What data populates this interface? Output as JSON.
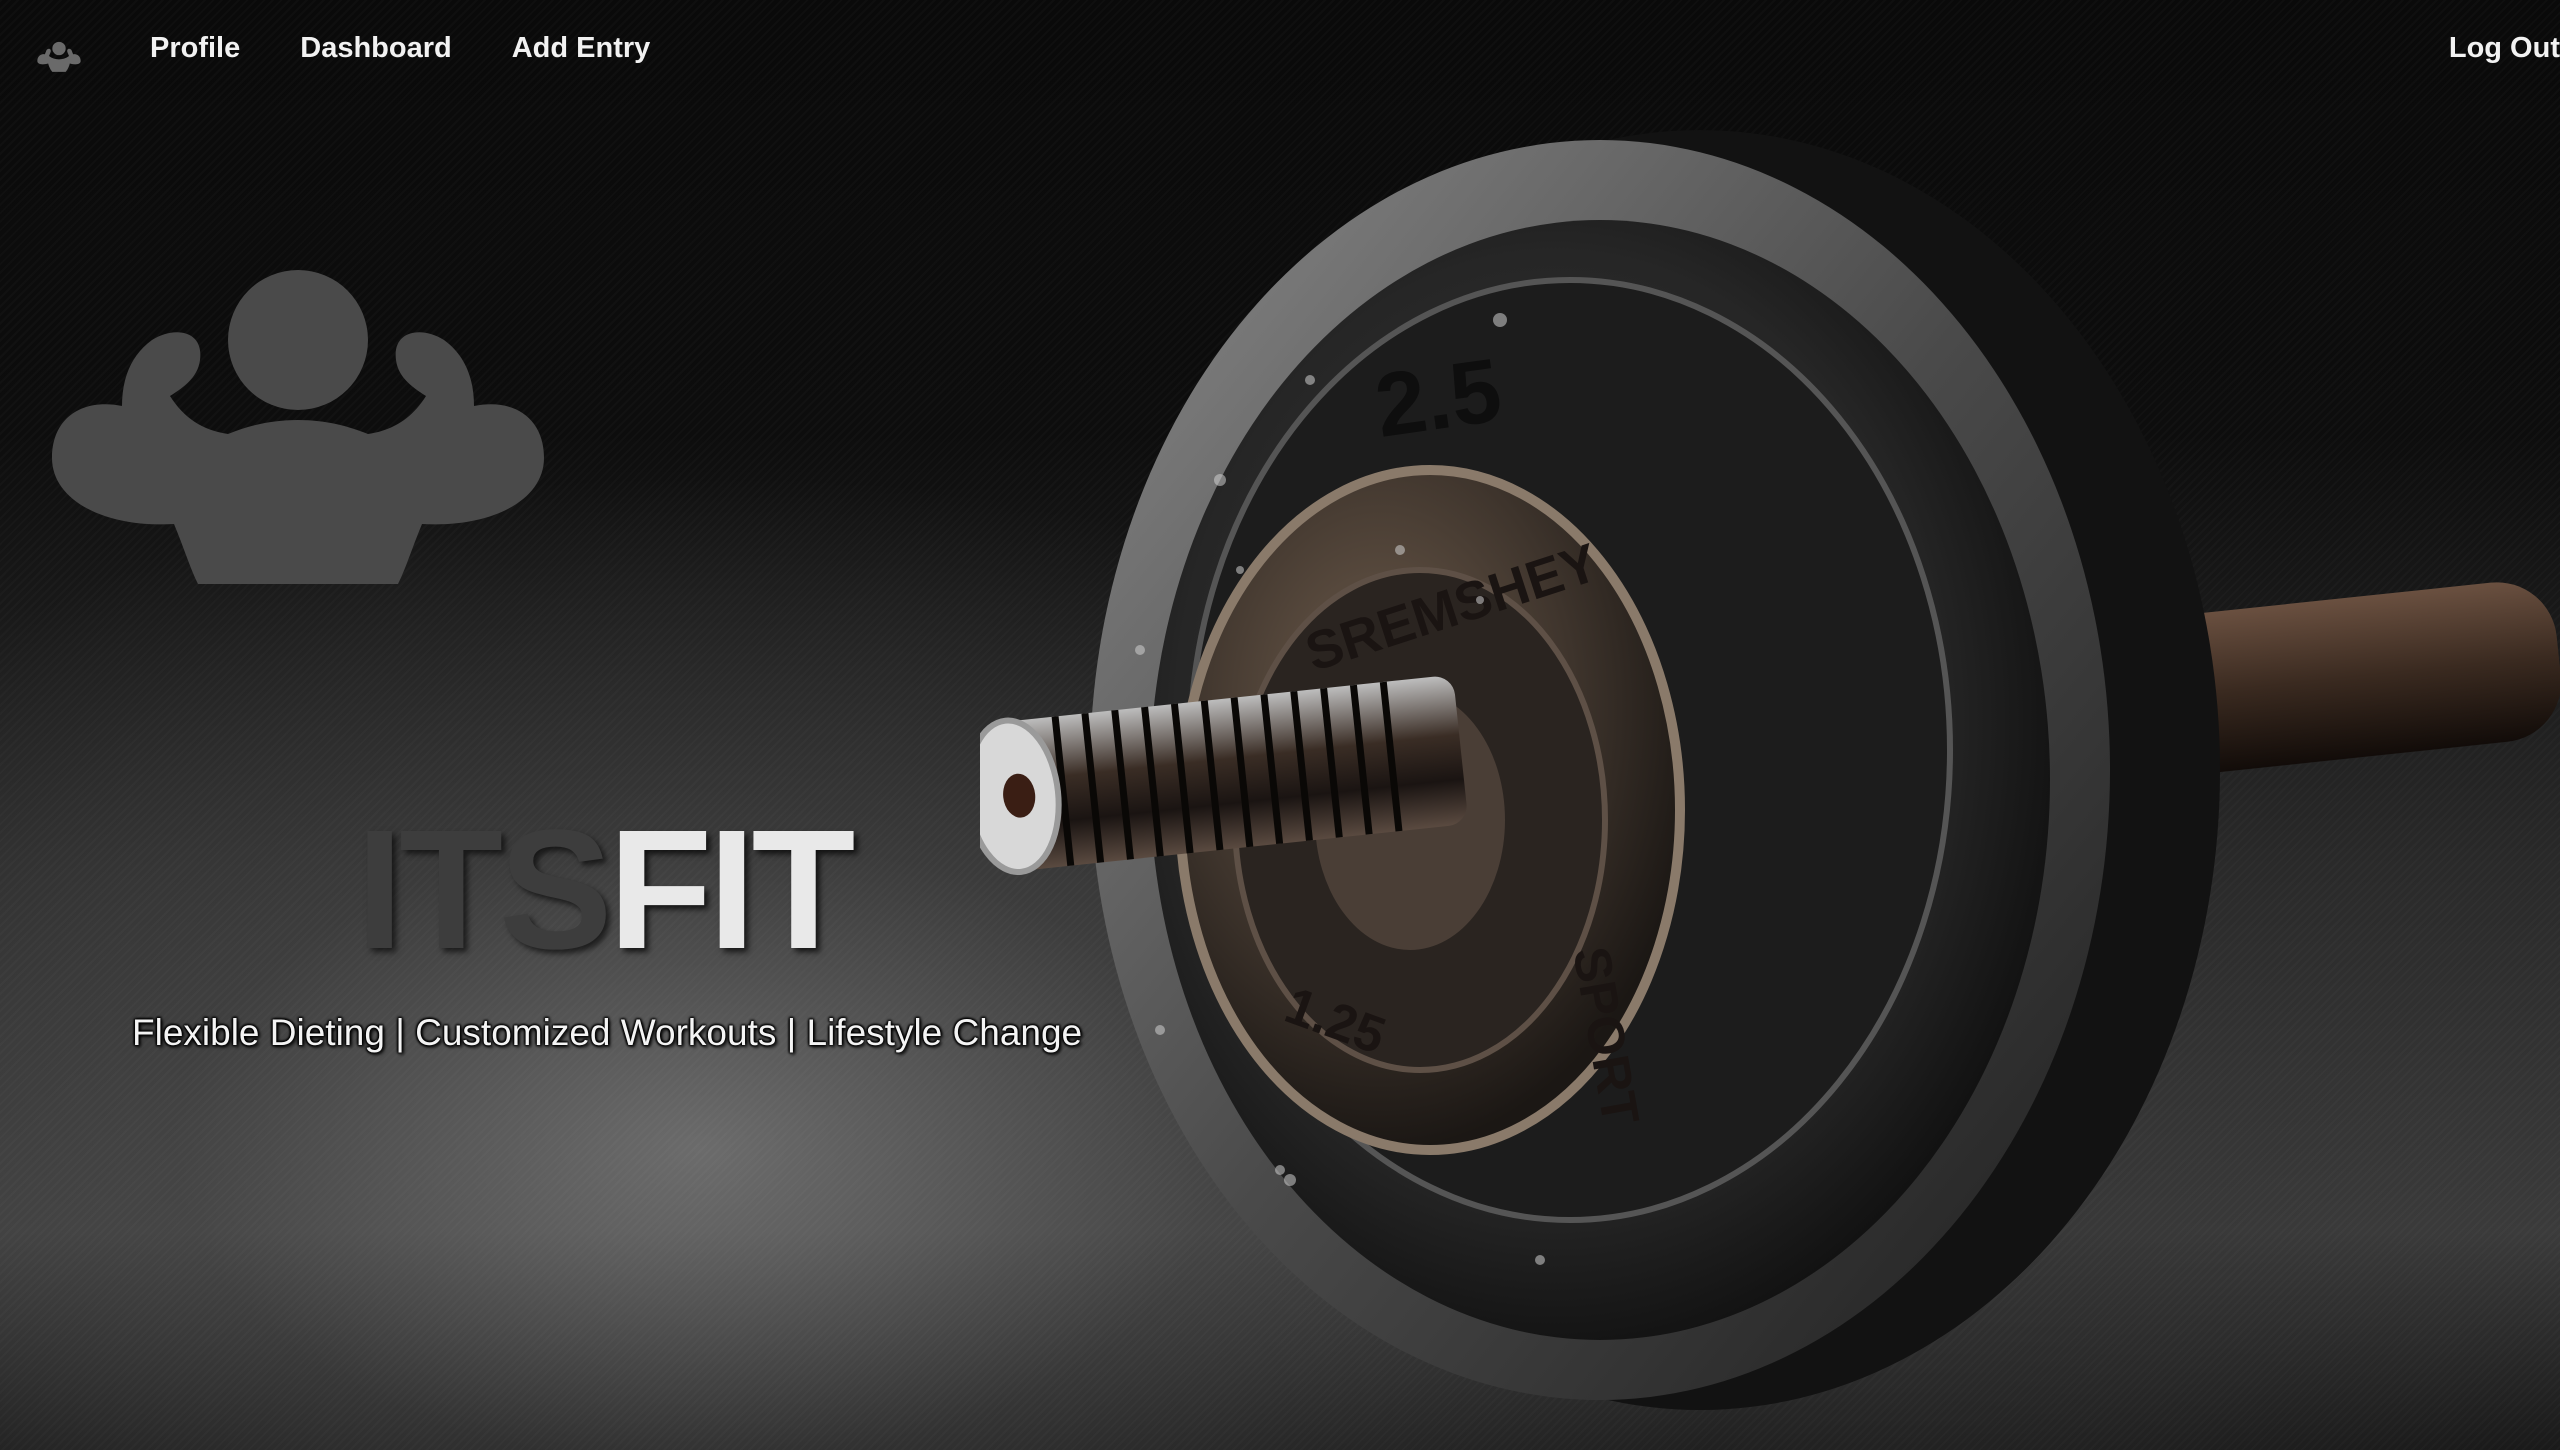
{
  "nav": {
    "logo_icon": "flexing-man-icon",
    "links": [
      {
        "label": "Profile"
      },
      {
        "label": "Dashboard"
      },
      {
        "label": "Add Entry"
      }
    ],
    "logout_label": "Log Out"
  },
  "hero": {
    "logo_icon": "flexing-man-icon",
    "title_part1": "ITS",
    "title_part2": "FIT",
    "tagline": "Flexible Dieting | Customized Workouts | Lifestyle Change"
  },
  "dumbbell_plates": {
    "plate_text_1": "SREMSHEY",
    "plate_text_2": "SPORT",
    "plate_text_3": "1.25",
    "plate_text_4": "2.5"
  },
  "colors": {
    "background": "#050505",
    "nav_text": "#f2f2f2",
    "title_dark": "#3d3d3d",
    "title_light": "#e9e9e9",
    "logo_gray": "#4a4a4a"
  }
}
